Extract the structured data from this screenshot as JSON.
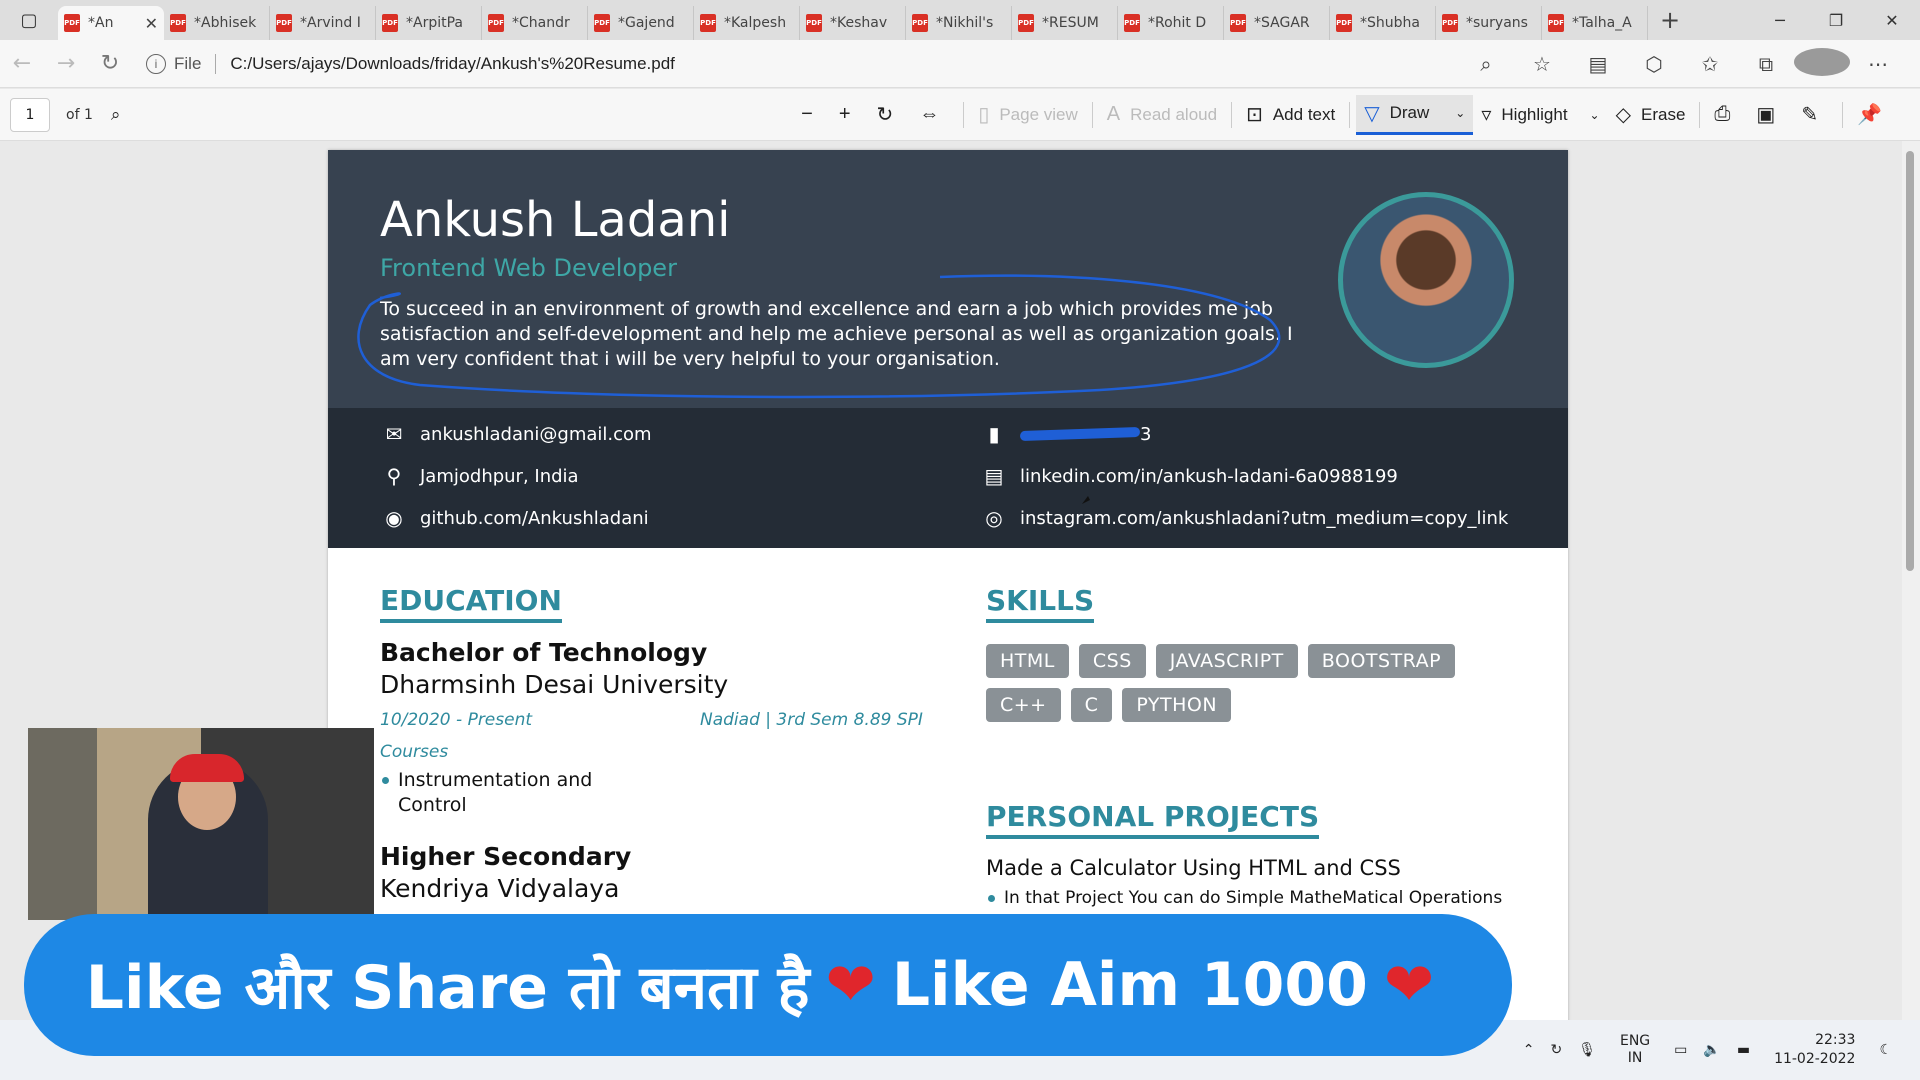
{
  "browser": {
    "tabs": [
      "*An",
      "*Abhisek",
      "*Arvind I",
      "*ArpitPa",
      "*Chandr",
      "*Gajend",
      "*Kalpesh",
      "*Keshav",
      "*Nikhil's",
      "*RESUM",
      "*Rohit D",
      "*SAGAR",
      "*Shubha",
      "*suryans",
      "*Talha_A"
    ],
    "new_tab": "+",
    "close_tab": "✕",
    "back": "←",
    "forward": "→",
    "refresh": "↻",
    "url_scheme": "File",
    "url": "C:/Users/ajays/Downloads/friday/Ankush's%20Resume.pdf"
  },
  "pdf_toolbar": {
    "page_number": "1",
    "page_of": "of 1",
    "page_view": "Page view",
    "read_aloud": "Read aloud",
    "add_text": "Add text",
    "draw": "Draw",
    "highlight": "Highlight",
    "erase": "Erase"
  },
  "resume": {
    "name": "Ankush Ladani",
    "role": "Frontend Web Developer",
    "objective": "To succeed in an environment of growth and excellence and earn a job which provides me job satisfaction and self-development and help me achieve personal as well as organization goals. I am very confident that i will be very helpful to your organisation.",
    "contact": {
      "email": "ankushladani@gmail.com",
      "location": "Jamjodhpur, India",
      "github": "github.com/Ankushladani",
      "phone_tail": "3",
      "linkedin": "linkedin.com/in/ankush-ladani-6a0988199",
      "instagram": "instagram.com/ankushladani?utm_medium=copy_link"
    },
    "education_title": "EDUCATION",
    "education": [
      {
        "degree": "Bachelor of Technology",
        "school": "Dharmsinh Desai University",
        "dates": "10/2020 - Present",
        "place": "Nadiad | 3rd Sem 8.89 SPI",
        "courses_label": "Courses",
        "course": "Instrumentation and Control"
      },
      {
        "degree": "Higher Secondary",
        "school": "Kendriya Vidyalaya"
      }
    ],
    "skills_title": "SKILLS",
    "skills": [
      "HTML",
      "CSS",
      "JAVASCRIPT",
      "BOOTSTRAP",
      "C++",
      "C",
      "PYTHON"
    ],
    "projects_title": "PERSONAL PROJECTS",
    "project_name": "Made a Calculator Using HTML and CSS",
    "project_desc": "In that Project You can do Simple MatheMatical Operations"
  },
  "overlay": {
    "banner_part1": "Like और Share तो बनता है",
    "banner_part2": "Like Aim 1000",
    "heart": "❤"
  },
  "tray": {
    "lang1": "ENG",
    "lang2": "IN",
    "time": "22:33",
    "date": "11-02-2022"
  },
  "colors": {
    "header_bg": "#374250",
    "contact_bg": "#242c36",
    "accent_teal": "#2f8b9e",
    "ink_blue": "#1f5fd6",
    "banner_blue": "#1e88e5"
  }
}
